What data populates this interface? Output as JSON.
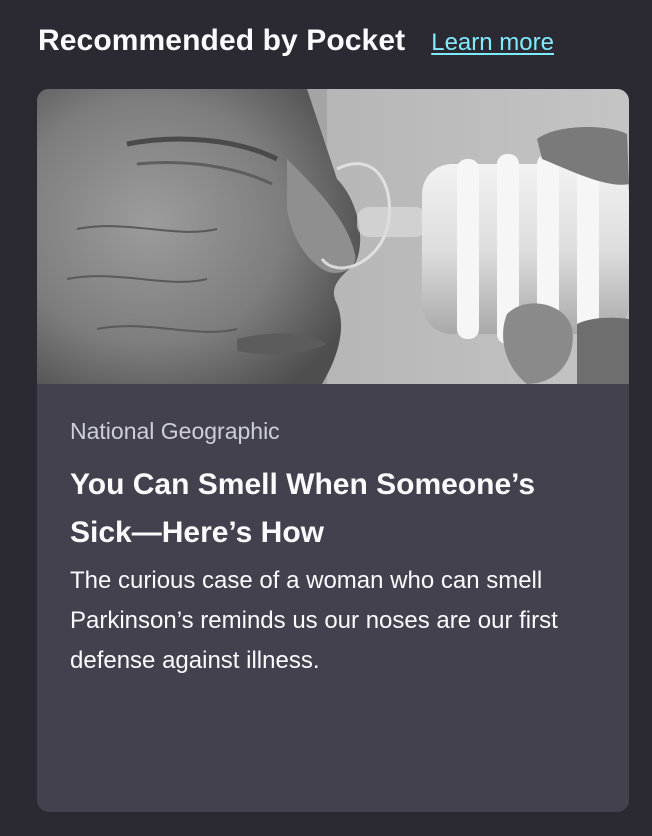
{
  "header": {
    "title": "Recommended by Pocket",
    "learn_more_label": "Learn more"
  },
  "card": {
    "image_icon": "photo-nose-smell-test",
    "source": "National Geographic",
    "title": "You Can Smell When Someone’s Sick—Here’s How",
    "excerpt": "The curious case of a woman who can smell Parkinson’s reminds us our noses are our first defense against illness."
  },
  "colors": {
    "background": "#2b2a33",
    "card": "#42414d",
    "link": "#80ebff",
    "text": "#fbfbfe",
    "muted_text": "#cfcfd8"
  }
}
